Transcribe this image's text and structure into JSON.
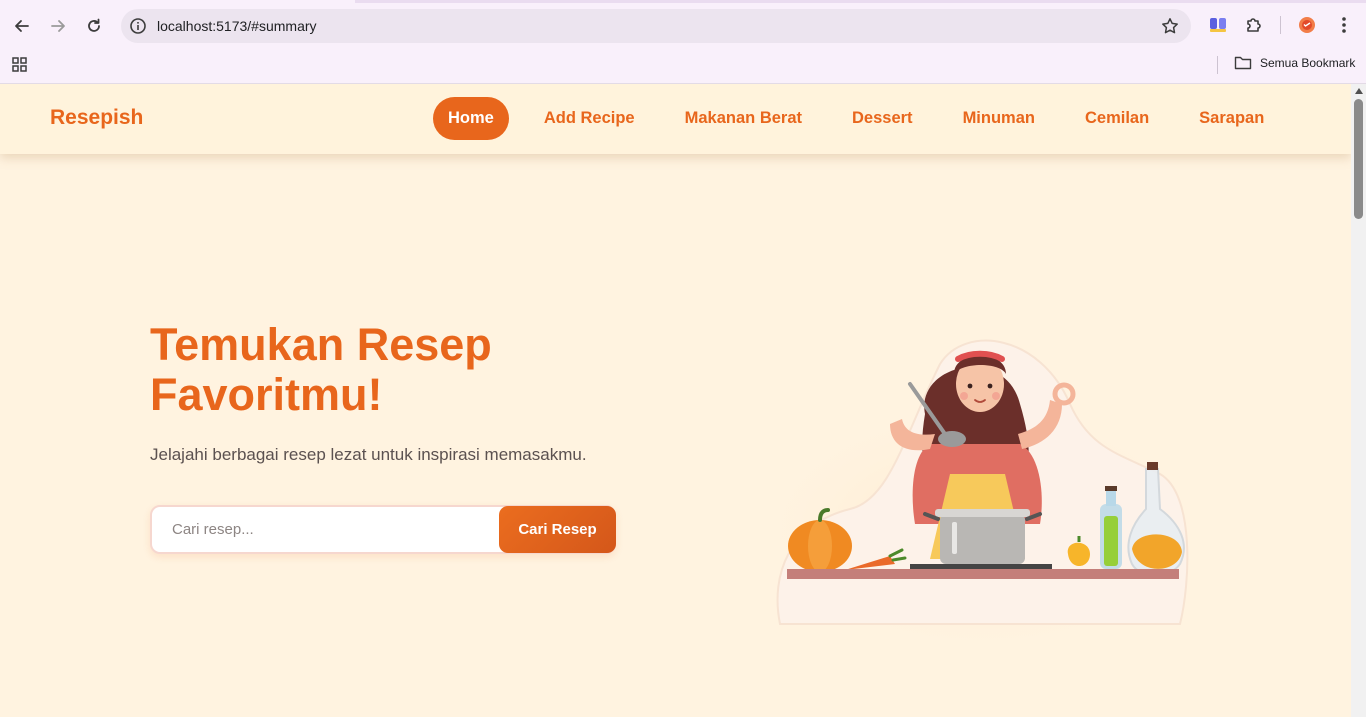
{
  "browser": {
    "url": "localhost:5173/#summary",
    "bookmarks_all_label": "Semua Bookmark"
  },
  "nav": {
    "brand": "Resepish",
    "links": [
      {
        "label": "Home",
        "active": true
      },
      {
        "label": "Add Recipe",
        "active": false
      },
      {
        "label": "Makanan Berat",
        "active": false
      },
      {
        "label": "Dessert",
        "active": false
      },
      {
        "label": "Minuman",
        "active": false
      },
      {
        "label": "Cemilan",
        "active": false
      },
      {
        "label": "Sarapan",
        "active": false
      }
    ]
  },
  "hero": {
    "title_line1": "Temukan Resep",
    "title_line2": "Favoritmu!",
    "subtitle": "Jelajahi berbagai resep lezat untuk inspirasi memasakmu.",
    "search_placeholder": "Cari resep...",
    "search_button": "Cari Resep"
  },
  "colors": {
    "accent": "#e8661c",
    "background": "#fff3e0",
    "text": "#5b5150"
  },
  "icons": [
    "back-arrow-icon",
    "forward-arrow-icon",
    "reload-icon",
    "site-info-icon",
    "bookmark-star-icon",
    "extension-icon",
    "puzzle-icon",
    "profile-icon",
    "kebab-menu-icon",
    "apps-grid-icon",
    "folder-icon"
  ]
}
